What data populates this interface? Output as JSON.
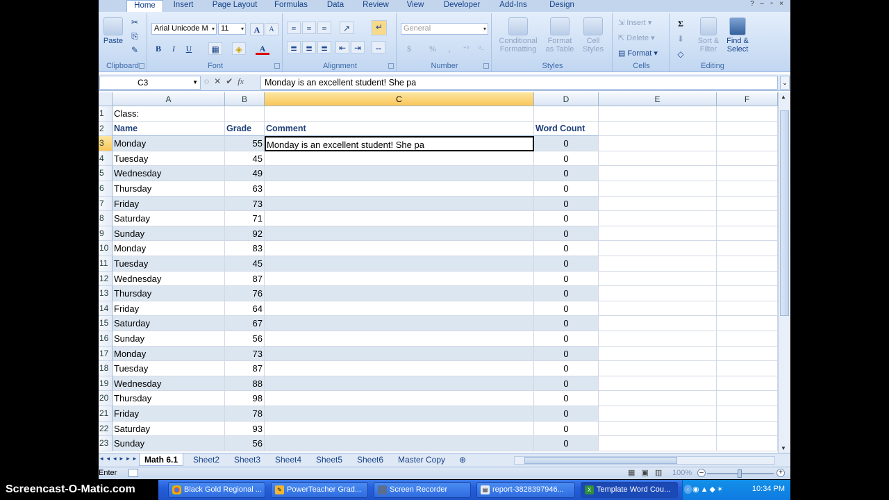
{
  "ribbon": {
    "tabs": [
      "Home",
      "Insert",
      "Page Layout",
      "Formulas",
      "Data",
      "Review",
      "View",
      "Developer",
      "Add-Ins",
      "Design"
    ],
    "active_tab": "Home",
    "clipboard": {
      "paste": "Paste",
      "label": "Clipboard"
    },
    "font": {
      "name": "Arial Unicode M",
      "size": "11",
      "bold": "B",
      "italic": "I",
      "underline": "U",
      "color_glyph": "A",
      "grow": "A",
      "shrink": "A",
      "label": "Font"
    },
    "alignment": {
      "label": "Alignment"
    },
    "number": {
      "format": "General",
      "currency": "$",
      "percent": "%",
      "comma": ",",
      "label": "Number"
    },
    "styles": {
      "conditional_1": "Conditional",
      "conditional_2": "Formatting",
      "format_table_1": "Format",
      "format_table_2": "as Table",
      "cell_styles_1": "Cell",
      "cell_styles_2": "Styles",
      "label": "Styles"
    },
    "cells": {
      "insert": "Insert",
      "delete": "Delete",
      "format": "Format",
      "label": "Cells"
    },
    "editing": {
      "sigma": "Σ",
      "sort_1": "Sort &",
      "sort_2": "Filter",
      "find_1": "Find &",
      "find_2": "Select",
      "label": "Editing"
    }
  },
  "formula_bar": {
    "name_box": "C3",
    "fx": "fx",
    "content": "Monday is an excellent student! She pa"
  },
  "columns": [
    {
      "letter": "A",
      "selected": false
    },
    {
      "letter": "B",
      "selected": false
    },
    {
      "letter": "C",
      "selected": true
    },
    {
      "letter": "D",
      "selected": false
    },
    {
      "letter": "E",
      "selected": false
    },
    {
      "letter": "F",
      "selected": false
    }
  ],
  "sheet": {
    "class_label": "Class:",
    "headers": {
      "name": "Name",
      "grade": "Grade",
      "comment": "Comment",
      "word_count": "Word Count"
    },
    "rows": [
      {
        "row": "3",
        "name": "Monday",
        "grade": "55",
        "comment": "Monday is an excellent student! She pa",
        "count": "0"
      },
      {
        "row": "4",
        "name": "Tuesday",
        "grade": "45",
        "comment": "",
        "count": "0"
      },
      {
        "row": "5",
        "name": "Wednesday",
        "grade": "49",
        "comment": "",
        "count": "0"
      },
      {
        "row": "6",
        "name": "Thursday",
        "grade": "63",
        "comment": "",
        "count": "0"
      },
      {
        "row": "7",
        "name": "Friday",
        "grade": "73",
        "comment": "",
        "count": "0"
      },
      {
        "row": "8",
        "name": "Saturday",
        "grade": "71",
        "comment": "",
        "count": "0"
      },
      {
        "row": "9",
        "name": "Sunday",
        "grade": "92",
        "comment": "",
        "count": "0"
      },
      {
        "row": "10",
        "name": "Monday",
        "grade": "83",
        "comment": "",
        "count": "0"
      },
      {
        "row": "11",
        "name": "Tuesday",
        "grade": "45",
        "comment": "",
        "count": "0"
      },
      {
        "row": "12",
        "name": "Wednesday",
        "grade": "87",
        "comment": "",
        "count": "0"
      },
      {
        "row": "13",
        "name": "Thursday",
        "grade": "76",
        "comment": "",
        "count": "0"
      },
      {
        "row": "14",
        "name": "Friday",
        "grade": "64",
        "comment": "",
        "count": "0"
      },
      {
        "row": "15",
        "name": "Saturday",
        "grade": "67",
        "comment": "",
        "count": "0"
      },
      {
        "row": "16",
        "name": "Sunday",
        "grade": "56",
        "comment": "",
        "count": "0"
      },
      {
        "row": "17",
        "name": "Monday",
        "grade": "73",
        "comment": "",
        "count": "0"
      },
      {
        "row": "18",
        "name": "Tuesday",
        "grade": "87",
        "comment": "",
        "count": "0"
      },
      {
        "row": "19",
        "name": "Wednesday",
        "grade": "88",
        "comment": "",
        "count": "0"
      },
      {
        "row": "20",
        "name": "Thursday",
        "grade": "98",
        "comment": "",
        "count": "0"
      },
      {
        "row": "21",
        "name": "Friday",
        "grade": "78",
        "comment": "",
        "count": "0"
      },
      {
        "row": "22",
        "name": "Saturday",
        "grade": "93",
        "comment": "",
        "count": "0"
      },
      {
        "row": "23",
        "name": "Sunday",
        "grade": "56",
        "comment": "",
        "count": "0"
      }
    ]
  },
  "sheet_tabs": [
    "Math 6.1",
    "Sheet2",
    "Sheet3",
    "Sheet4",
    "Sheet5",
    "Sheet6",
    "Master Copy"
  ],
  "active_sheet": "Math 6.1",
  "status": {
    "mode": "Enter",
    "zoom": "100%"
  },
  "watermark": "Screencast-O-Matic.com",
  "taskbar": {
    "items": [
      {
        "label": "Black Gold Regional ...",
        "icon": "chrome-icon"
      },
      {
        "label": "PowerTeacher Grad...",
        "icon": "pencil-icon"
      },
      {
        "label": "Screen Recorder",
        "icon": "monitor-icon"
      },
      {
        "label": "report-3828397946...",
        "icon": "document-icon"
      },
      {
        "label": "Template Word Cou...",
        "icon": "excel-icon"
      }
    ],
    "active_item": "Template Word Cou...",
    "clock": "10:34 PM"
  },
  "colors": {
    "ribbon_blue": "#c3d5ec",
    "table_band": "#dce6f1",
    "selected_header": "#f9c65a",
    "taskbar": "#245edb"
  }
}
